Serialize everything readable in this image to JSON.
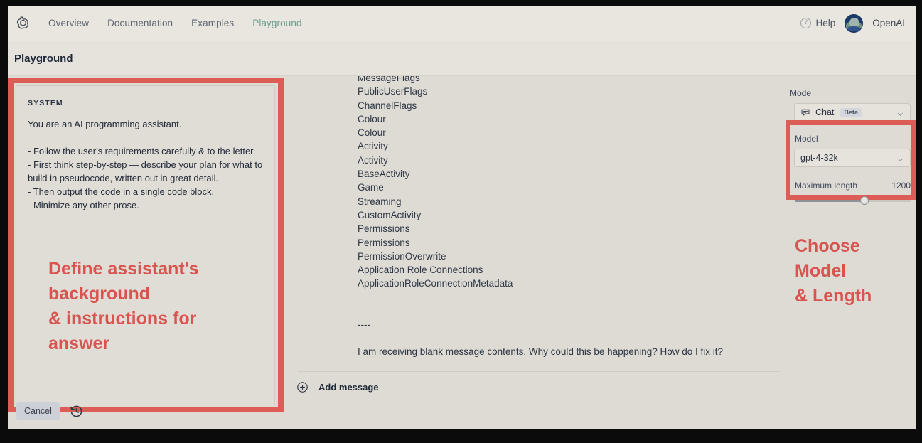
{
  "nav": {
    "logo_icon": "openai-logo-icon",
    "links": [
      {
        "label": "Overview",
        "active": false
      },
      {
        "label": "Documentation",
        "active": false
      },
      {
        "label": "Examples",
        "active": false
      },
      {
        "label": "Playground",
        "active": true
      }
    ],
    "help_label": "Help",
    "help_icon": "question-mark-circle-icon",
    "username": "OpenAI"
  },
  "page": {
    "title": "Playground"
  },
  "system_panel": {
    "label": "SYSTEM",
    "text": "You are an AI programming assistant.\n\n- Follow the user's requirements carefully & to the letter.\n- First think step-by-step — describe your plan for what to build in pseudocode, written out in great detail.\n- Then output the code in a single code block.\n- Minimize any other prose."
  },
  "annotations": {
    "left": "Define assistant's\nbackground\n& instructions for\nanswer",
    "right": "Choose\nModel\n& Length",
    "color": "#d9534f"
  },
  "actions": {
    "cancel_label": "Cancel",
    "history_icon": "history-clock-icon"
  },
  "conversation": {
    "assistant_message": "MessageFlags\nPublicUserFlags\nChannelFlags\nColour\nColour\nActivity\nActivity\nBaseActivity\nGame\nStreaming\nCustomActivity\nPermissions\nPermissions\nPermissionOverwrite\nApplication Role Connections\nApplicationRoleConnectionMetadata\n\n\n----",
    "user_message": "I am receiving blank message contents. Why could this be happening? How do I fix it?",
    "add_message_label": "Add message",
    "add_message_icon": "plus-circle-icon"
  },
  "controls": {
    "mode_label": "Mode",
    "mode_value": "Chat",
    "mode_badge": "Beta",
    "mode_icon": "chat-bubble-icon",
    "model_label": "Model",
    "model_value": "gpt-4-32k",
    "max_length_label": "Maximum length",
    "max_length_value": "1200",
    "slider_percent": 60,
    "chevron_icon": "chevron-down-icon"
  }
}
